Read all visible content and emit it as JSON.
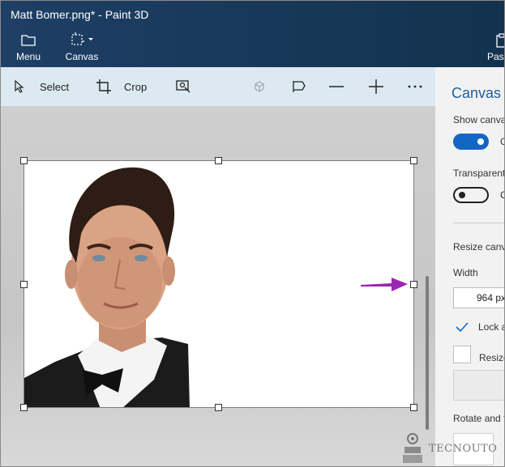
{
  "window": {
    "title": "Matt Bomer.png* - Paint 3D"
  },
  "ribbon": {
    "menu_label": "Menu",
    "canvas_label": "Canvas",
    "paste_label": "Pas"
  },
  "toolbar": {
    "select_label": "Select",
    "crop_label": "Crop"
  },
  "panel": {
    "title": "Canvas",
    "show_canvas_label": "Show canva",
    "show_canvas_state": "C",
    "transparent_label": "Transparent",
    "transparent_state": "C",
    "resize_label": "Resize canva",
    "width_label": "Width",
    "width_value": "964 px",
    "lock_label": "Lock a",
    "resize_image_label": "Resize",
    "rotate_label": "Rotate and f"
  },
  "watermark": {
    "text": "TECNOUTO"
  },
  "colors": {
    "ribbon": "#173858",
    "toolbar": "#dce9f1",
    "accent": "#1366c4",
    "arrow": "#9b27b0"
  }
}
